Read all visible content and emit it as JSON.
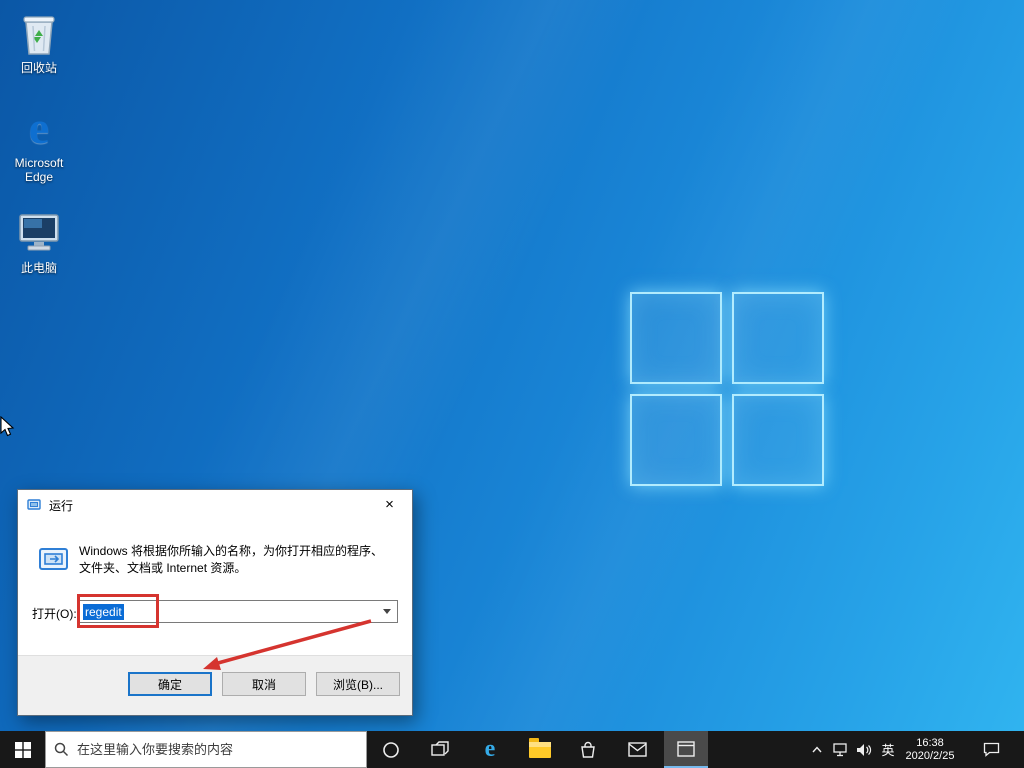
{
  "desktop": {
    "icons": [
      {
        "label": "回收站"
      },
      {
        "label": "Microsoft Edge"
      },
      {
        "label": "此电脑"
      }
    ]
  },
  "run_dialog": {
    "title": "运行",
    "description_line1": "Windows 将根据你所输入的名称，为你打开相应的程序、",
    "description_line2": "文件夹、文档或 Internet 资源。",
    "open_label": "打开(O):",
    "input_value": "regedit",
    "ok_label": "确定",
    "cancel_label": "取消",
    "browse_label": "浏览(B)..."
  },
  "taskbar": {
    "search_placeholder": "在这里输入你要搜索的内容",
    "ime_indicator": "英",
    "time": "16:38",
    "date": "2020/2/25"
  },
  "glyphs": {
    "close": "×",
    "edge_letter": "e"
  },
  "colors": {
    "selection": "#0a6cd6",
    "annotation_red": "#d5342f",
    "taskbar_active_underline": "#76b9ed",
    "accent_blue": "#0078d7"
  }
}
